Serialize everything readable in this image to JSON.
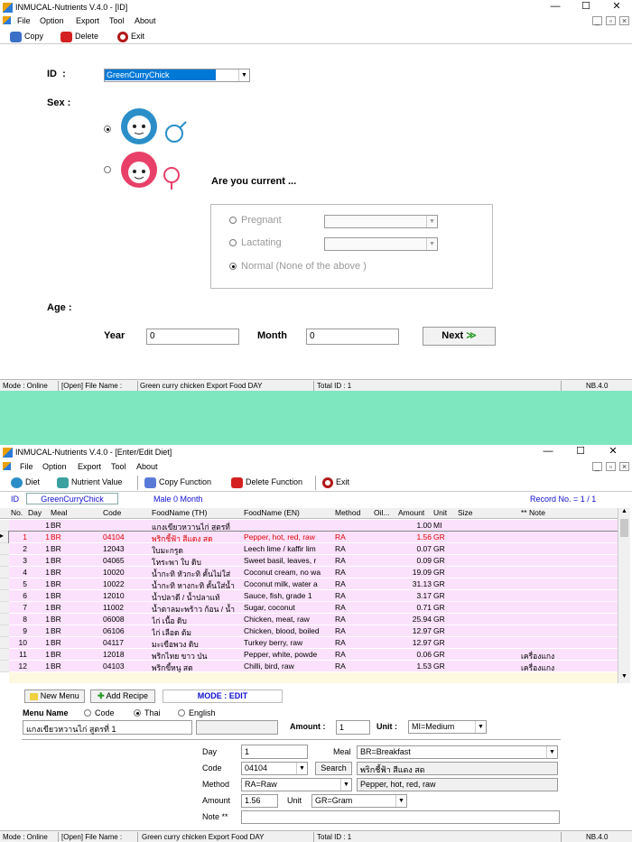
{
  "window1": {
    "title": "INMUCAL-Nutrients V.4.0 - [ID]",
    "menu": [
      "File",
      "Option",
      "Export",
      "Tool",
      "About"
    ],
    "toolbar": {
      "copy": "Copy",
      "delete": "Delete",
      "exit": "Exit"
    },
    "id_label": "ID  :",
    "id_value": "GreenCurryChick",
    "sex_label": "Sex :",
    "sex_selected": "male",
    "current_question": "Are you current ...",
    "options": {
      "pregnant": "Pregnant",
      "lactating": "Lactating",
      "normal": "Normal (None of the above )"
    },
    "age_label": "Age :",
    "year_label": "Year",
    "year_value": "0",
    "month_label": "Month",
    "month_value": "0",
    "next_label": "Next",
    "status": {
      "mode": "Mode : Online",
      "file": "[Open] File Name :",
      "filename": "Green curry chicken Export Food DAY",
      "total": "Total ID : 1",
      "nb": "NB.4.0"
    }
  },
  "window2": {
    "title": "INMUCAL-Nutrients V.4.0 - [Enter/Edit Diet]",
    "menu": [
      "File",
      "Option",
      "Export",
      "Tool",
      "About"
    ],
    "toolbar": {
      "diet": "Diet",
      "nutrient": "Nutrient Value",
      "copy_function": "Copy Function",
      "delete_function": "Delete Function",
      "exit": "Exit"
    },
    "id_label": "ID",
    "id_value": "GreenCurryChick",
    "person_info": "Male 0 Month",
    "record_info": "Record No. = 1 / 1",
    "columns": [
      "No.",
      "Day",
      "Meal",
      "Code",
      "FoodName (TH)",
      "FoodName (EN)",
      "Method",
      "Oil...",
      "Amount",
      "Unit",
      "Size",
      "** Note"
    ],
    "rows": [
      [
        "",
        "1",
        "BR",
        "",
        "แกงเขียวหวานไก่ สูตรที่",
        "",
        "",
        "",
        "1.00",
        "MI",
        "",
        ""
      ],
      [
        "1",
        "1",
        "BR",
        "04104",
        "พริกชี้ฟ้า สีแดง สด",
        "Pepper, hot, red, raw",
        "RA",
        "",
        "1.56",
        "GR",
        "",
        ""
      ],
      [
        "2",
        "1",
        "BR",
        "12043",
        "ใบมะกรูด",
        "Leech lime / kaffir lim",
        "RA",
        "",
        "0.07",
        "GR",
        "",
        ""
      ],
      [
        "3",
        "1",
        "BR",
        "04065",
        "โหระพา ใบ ดิบ",
        "Sweet basil, leaves, r",
        "RA",
        "",
        "0.09",
        "GR",
        "",
        ""
      ],
      [
        "4",
        "1",
        "BR",
        "10020",
        "น้ำกะทิ หัวกะทิ คั้นไม่ใส่",
        "Coconut cream, no wa",
        "RA",
        "",
        "19.09",
        "GR",
        "",
        ""
      ],
      [
        "5",
        "1",
        "BR",
        "10022",
        "น้ำกะทิ หางกะทิ คั้นใส่น้ำ",
        "Coconut milk, water a",
        "RA",
        "",
        "31.13",
        "GR",
        "",
        ""
      ],
      [
        "6",
        "1",
        "BR",
        "12010",
        "น้ำปลาดี / น้ำปลาแท้",
        "Sauce, fish, grade 1",
        "RA",
        "",
        "3.17",
        "GR",
        "",
        ""
      ],
      [
        "7",
        "1",
        "BR",
        "11002",
        "น้ำตาลมะพร้าว ก้อน / น้ำ",
        "Sugar, coconut",
        "RA",
        "",
        "0.71",
        "GR",
        "",
        ""
      ],
      [
        "8",
        "1",
        "BR",
        "06008",
        "ไก่ เนื้อ ดิบ",
        "Chicken, meat, raw",
        "RA",
        "",
        "25.94",
        "GR",
        "",
        ""
      ],
      [
        "9",
        "1",
        "BR",
        "06106",
        "ไก่ เลือด ต้ม",
        "Chicken, blood, boiled",
        "RA",
        "",
        "12.97",
        "GR",
        "",
        ""
      ],
      [
        "10",
        "1",
        "BR",
        "04117",
        "มะเขือพวง ดิบ",
        "Turkey berry, raw",
        "RA",
        "",
        "12.97",
        "GR",
        "",
        ""
      ],
      [
        "11",
        "1",
        "BR",
        "12018",
        "พริกไทย ขาว ป่น",
        "Pepper, white, powde",
        "RA",
        "",
        "0.06",
        "GR",
        "",
        "เครื่องแกง"
      ],
      [
        "12",
        "1",
        "BR",
        "04103",
        "พริกขี้หนู สด",
        "Chilli, bird, raw",
        "RA",
        "",
        "1.53",
        "GR",
        "",
        "เครื่องแกง"
      ]
    ],
    "new_menu": "New Menu",
    "add_recipe": "Add Recipe",
    "mode_edit": "MODE : EDIT",
    "menu_name_label": "Menu Name",
    "radio_code": "Code",
    "radio_thai": "Thai",
    "radio_english": "English",
    "menu_name_value": "แกงเขียวหวานไก่ สูตรที่ 1",
    "amount_label": "Amount :",
    "amount_value": "1",
    "unit_label": "Unit :",
    "unit_value": "MI=Medium",
    "day_label": "Day",
    "day_value": "1",
    "meal_label": "Meal",
    "meal_value": "BR=Breakfast",
    "code_label": "Code",
    "code_value": "04104",
    "search_label": "Search",
    "food_th": "พริกชี้ฟ้า สีแดง สด",
    "method_label": "Method",
    "method_value": "RA=Raw",
    "food_en": "Pepper, hot, red, raw",
    "amount2_label": "Amount",
    "amount2_value": "1.56",
    "unit2_label": "Unit",
    "unit2_value": "GR=Gram",
    "note_label": "Note **",
    "status": {
      "mode": "Mode : Online",
      "file": "[Open] File Name :",
      "filename": "Green curry chicken Export Food DAY",
      "total": "Total ID : 1",
      "nb": "NB.4.0"
    }
  },
  "colors": {
    "separator": "#7ee7c0",
    "row_bg": "#fbe1fb",
    "selected_text": "#e00000",
    "id_highlight": "#0078d7",
    "mode_text": "#1010d0"
  }
}
